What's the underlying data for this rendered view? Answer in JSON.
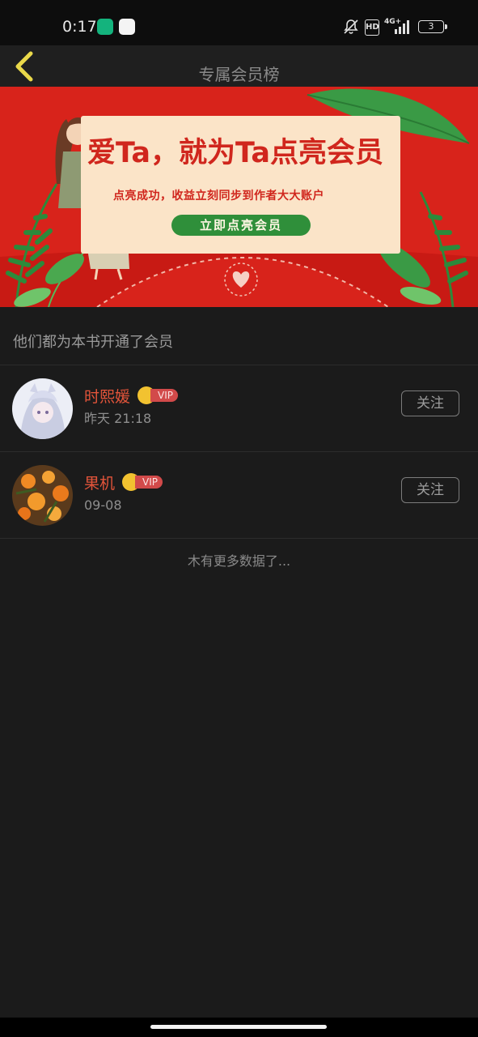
{
  "status_bar": {
    "time": "0:17",
    "network": "4G+",
    "hd": "HD",
    "battery": "3"
  },
  "header": {
    "title": "专属会员榜",
    "back_icon": "chevron-left-icon"
  },
  "banner": {
    "title": "爱Ta，就为Ta点亮会员",
    "subtitle": "点亮成功，收益立刻同步到作者大大账户",
    "cta": "立即点亮会员"
  },
  "section": {
    "label": "他们都为本书开通了会员"
  },
  "members": [
    {
      "name": "时熙媛",
      "vip": "VIP",
      "time": "昨天 21:18",
      "follow": "关注"
    },
    {
      "name": "果机",
      "vip": "VIP",
      "time": "09-08",
      "follow": "关注"
    }
  ],
  "footer": {
    "note": "木有更多数据了..."
  },
  "colors": {
    "background": "#1b1b1b",
    "accent_name": "#e2543a",
    "banner_red": "#d8231b",
    "banner_green": "#2f8f3a",
    "back_arrow": "#e9d84a"
  }
}
